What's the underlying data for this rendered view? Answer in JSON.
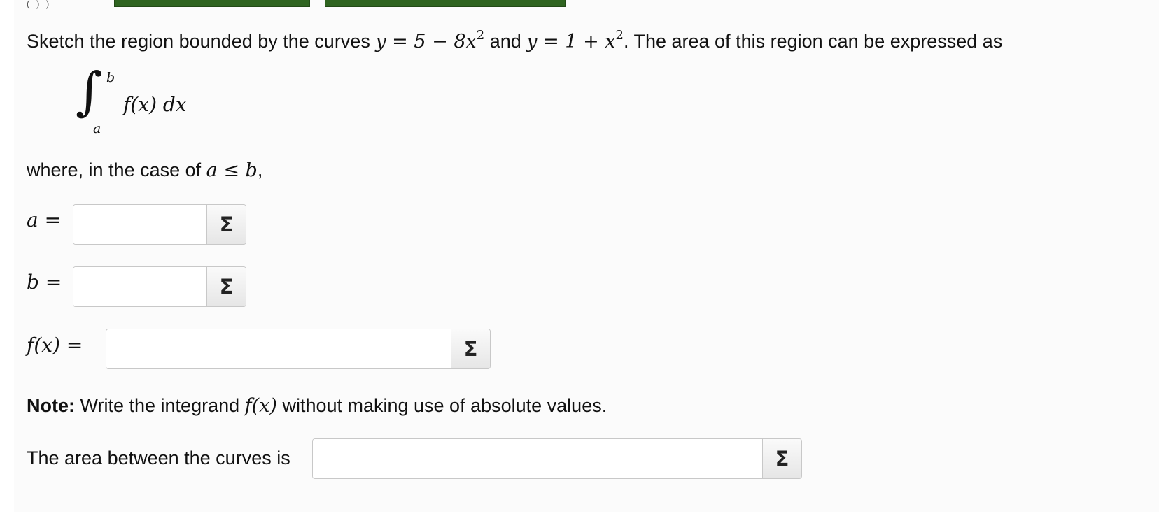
{
  "top_strip": {
    "clipped_glyphs": "( ) )"
  },
  "question": {
    "lead": "Sketch the region bounded by the curves ",
    "curve1": "y = 5 − 8x",
    "curve1_exp": "2",
    "connector": " and ",
    "curve2": "y = 1 + x",
    "curve2_exp": "2",
    "tail": ". The area of this region can be expressed as"
  },
  "integral": {
    "sign": "∫",
    "upper": "b",
    "lower": "a",
    "integrand": "f(x) dx"
  },
  "condition": {
    "lead": "where, in the case of ",
    "expr": "a ≤ b",
    "tail": ","
  },
  "fields": {
    "a": {
      "label": "a =",
      "value": ""
    },
    "b": {
      "label": "b =",
      "value": ""
    },
    "fx": {
      "label": "f(x) =",
      "value": ""
    },
    "area": {
      "label": "The area between the curves is",
      "value": ""
    }
  },
  "note": {
    "bold": "Note:",
    "lead": " Write the integrand ",
    "expr": "f(x)",
    "tail": " without making use of absolute values."
  },
  "sigma_symbol": "Σ",
  "colors": {
    "top_buttons": "#2f6420",
    "panel_background": "#fbfbfb",
    "input_border": "#c8c8c8"
  }
}
